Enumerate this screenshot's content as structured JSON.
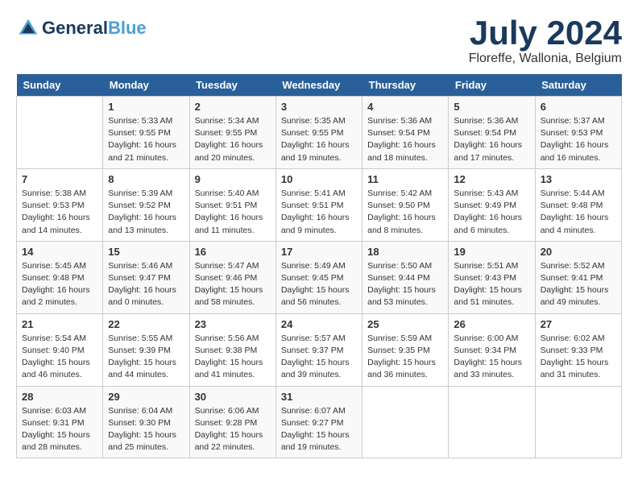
{
  "header": {
    "logo_line1": "General",
    "logo_line2": "Blue",
    "month_year": "July 2024",
    "location": "Floreffe, Wallonia, Belgium"
  },
  "weekdays": [
    "Sunday",
    "Monday",
    "Tuesday",
    "Wednesday",
    "Thursday",
    "Friday",
    "Saturday"
  ],
  "weeks": [
    [
      {
        "num": "",
        "info": ""
      },
      {
        "num": "1",
        "info": "Sunrise: 5:33 AM\nSunset: 9:55 PM\nDaylight: 16 hours\nand 21 minutes."
      },
      {
        "num": "2",
        "info": "Sunrise: 5:34 AM\nSunset: 9:55 PM\nDaylight: 16 hours\nand 20 minutes."
      },
      {
        "num": "3",
        "info": "Sunrise: 5:35 AM\nSunset: 9:55 PM\nDaylight: 16 hours\nand 19 minutes."
      },
      {
        "num": "4",
        "info": "Sunrise: 5:36 AM\nSunset: 9:54 PM\nDaylight: 16 hours\nand 18 minutes."
      },
      {
        "num": "5",
        "info": "Sunrise: 5:36 AM\nSunset: 9:54 PM\nDaylight: 16 hours\nand 17 minutes."
      },
      {
        "num": "6",
        "info": "Sunrise: 5:37 AM\nSunset: 9:53 PM\nDaylight: 16 hours\nand 16 minutes."
      }
    ],
    [
      {
        "num": "7",
        "info": "Sunrise: 5:38 AM\nSunset: 9:53 PM\nDaylight: 16 hours\nand 14 minutes."
      },
      {
        "num": "8",
        "info": "Sunrise: 5:39 AM\nSunset: 9:52 PM\nDaylight: 16 hours\nand 13 minutes."
      },
      {
        "num": "9",
        "info": "Sunrise: 5:40 AM\nSunset: 9:51 PM\nDaylight: 16 hours\nand 11 minutes."
      },
      {
        "num": "10",
        "info": "Sunrise: 5:41 AM\nSunset: 9:51 PM\nDaylight: 16 hours\nand 9 minutes."
      },
      {
        "num": "11",
        "info": "Sunrise: 5:42 AM\nSunset: 9:50 PM\nDaylight: 16 hours\nand 8 minutes."
      },
      {
        "num": "12",
        "info": "Sunrise: 5:43 AM\nSunset: 9:49 PM\nDaylight: 16 hours\nand 6 minutes."
      },
      {
        "num": "13",
        "info": "Sunrise: 5:44 AM\nSunset: 9:48 PM\nDaylight: 16 hours\nand 4 minutes."
      }
    ],
    [
      {
        "num": "14",
        "info": "Sunrise: 5:45 AM\nSunset: 9:48 PM\nDaylight: 16 hours\nand 2 minutes."
      },
      {
        "num": "15",
        "info": "Sunrise: 5:46 AM\nSunset: 9:47 PM\nDaylight: 16 hours\nand 0 minutes."
      },
      {
        "num": "16",
        "info": "Sunrise: 5:47 AM\nSunset: 9:46 PM\nDaylight: 15 hours\nand 58 minutes."
      },
      {
        "num": "17",
        "info": "Sunrise: 5:49 AM\nSunset: 9:45 PM\nDaylight: 15 hours\nand 56 minutes."
      },
      {
        "num": "18",
        "info": "Sunrise: 5:50 AM\nSunset: 9:44 PM\nDaylight: 15 hours\nand 53 minutes."
      },
      {
        "num": "19",
        "info": "Sunrise: 5:51 AM\nSunset: 9:43 PM\nDaylight: 15 hours\nand 51 minutes."
      },
      {
        "num": "20",
        "info": "Sunrise: 5:52 AM\nSunset: 9:41 PM\nDaylight: 15 hours\nand 49 minutes."
      }
    ],
    [
      {
        "num": "21",
        "info": "Sunrise: 5:54 AM\nSunset: 9:40 PM\nDaylight: 15 hours\nand 46 minutes."
      },
      {
        "num": "22",
        "info": "Sunrise: 5:55 AM\nSunset: 9:39 PM\nDaylight: 15 hours\nand 44 minutes."
      },
      {
        "num": "23",
        "info": "Sunrise: 5:56 AM\nSunset: 9:38 PM\nDaylight: 15 hours\nand 41 minutes."
      },
      {
        "num": "24",
        "info": "Sunrise: 5:57 AM\nSunset: 9:37 PM\nDaylight: 15 hours\nand 39 minutes."
      },
      {
        "num": "25",
        "info": "Sunrise: 5:59 AM\nSunset: 9:35 PM\nDaylight: 15 hours\nand 36 minutes."
      },
      {
        "num": "26",
        "info": "Sunrise: 6:00 AM\nSunset: 9:34 PM\nDaylight: 15 hours\nand 33 minutes."
      },
      {
        "num": "27",
        "info": "Sunrise: 6:02 AM\nSunset: 9:33 PM\nDaylight: 15 hours\nand 31 minutes."
      }
    ],
    [
      {
        "num": "28",
        "info": "Sunrise: 6:03 AM\nSunset: 9:31 PM\nDaylight: 15 hours\nand 28 minutes."
      },
      {
        "num": "29",
        "info": "Sunrise: 6:04 AM\nSunset: 9:30 PM\nDaylight: 15 hours\nand 25 minutes."
      },
      {
        "num": "30",
        "info": "Sunrise: 6:06 AM\nSunset: 9:28 PM\nDaylight: 15 hours\nand 22 minutes."
      },
      {
        "num": "31",
        "info": "Sunrise: 6:07 AM\nSunset: 9:27 PM\nDaylight: 15 hours\nand 19 minutes."
      },
      {
        "num": "",
        "info": ""
      },
      {
        "num": "",
        "info": ""
      },
      {
        "num": "",
        "info": ""
      }
    ]
  ]
}
